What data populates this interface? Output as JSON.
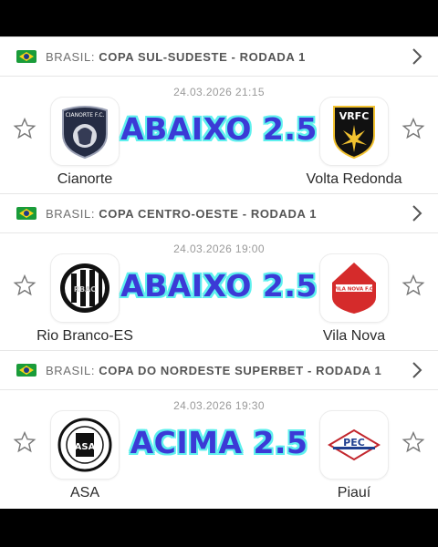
{
  "colors": {
    "tip_text": "#3b3ad6",
    "tip_outline": "#5ff0ee",
    "flag_green": "#1a9c3a"
  },
  "matches": [
    {
      "league_country": "BRASIL:",
      "league_name": "COPA SUL-SUDESTE - RODADA 1",
      "datetime": "24.03.2026 21:15",
      "home": "Cianorte",
      "away": "Volta Redonda",
      "tip": "ABAIXO 2.5",
      "home_logo_text": "CIANORTE F.C.",
      "away_logo_text": "VRFC"
    },
    {
      "league_country": "BRASIL:",
      "league_name": "COPA CENTRO-OESTE - RODADA 1",
      "datetime": "24.03.2026 19:00",
      "home": "Rio Branco-ES",
      "away": "Vila Nova",
      "tip": "ABAIXO 2.5",
      "home_logo_text": "RBAC",
      "away_logo_text": "VILA NOVA F.C."
    },
    {
      "league_country": "BRASIL:",
      "league_name": "COPA DO NORDESTE SUPERBET - RODADA 1",
      "datetime": "24.03.2026 19:30",
      "home": "ASA",
      "away": "Piauí",
      "tip": "ACIMA 2.5",
      "home_logo_text": "ASA",
      "away_logo_text": "PEC"
    }
  ]
}
